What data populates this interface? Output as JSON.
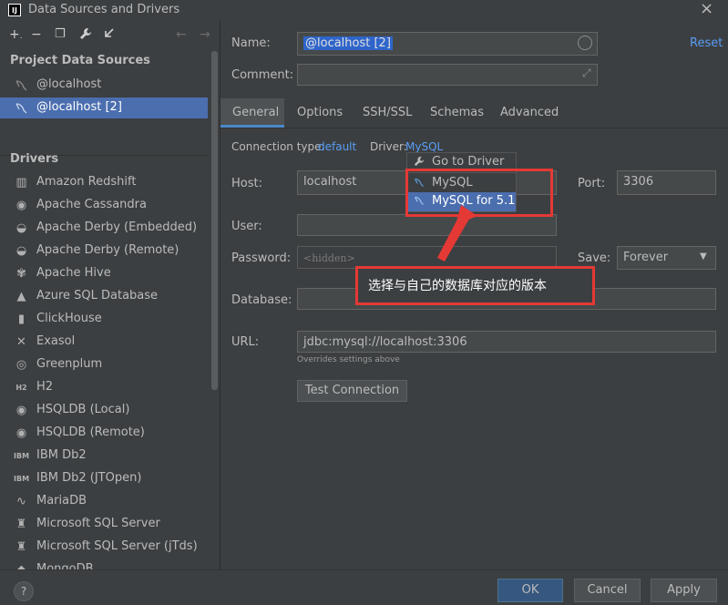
{
  "window": {
    "title": "Data Sources and Drivers",
    "logo": "IJ"
  },
  "toolbar": {
    "icons": [
      {
        "name": "add-icon",
        "glyph": "+."
      },
      {
        "name": "remove-icon",
        "glyph": "−"
      },
      {
        "name": "duplicate-icon",
        "glyph": "❐"
      },
      {
        "name": "wrench-icon",
        "glyph": "🔧"
      },
      {
        "name": "import-icon",
        "glyph": "↙"
      },
      {
        "name": "back-icon",
        "glyph": "←"
      },
      {
        "name": "forward-icon",
        "glyph": "→"
      }
    ]
  },
  "left": {
    "project_header": "Project Data Sources",
    "data_sources": [
      {
        "label": "@localhost",
        "selected": false
      },
      {
        "label": "@localhost [2]",
        "selected": true
      }
    ],
    "drivers_header": "Drivers",
    "drivers": [
      {
        "label": "Amazon Redshift",
        "icon": "▥"
      },
      {
        "label": "Apache Cassandra",
        "icon": "◉"
      },
      {
        "label": "Apache Derby (Embedded)",
        "icon": "◒"
      },
      {
        "label": "Apache Derby (Remote)",
        "icon": "◒"
      },
      {
        "label": "Apache Hive",
        "icon": "✾"
      },
      {
        "label": "Azure SQL Database",
        "icon": "▲"
      },
      {
        "label": "ClickHouse",
        "icon": "▮"
      },
      {
        "label": "Exasol",
        "icon": "✕"
      },
      {
        "label": "Greenplum",
        "icon": "◎"
      },
      {
        "label": "H2",
        "icon": "H2"
      },
      {
        "label": "HSQLDB (Local)",
        "icon": "◉"
      },
      {
        "label": "HSQLDB (Remote)",
        "icon": "◉"
      },
      {
        "label": "IBM Db2",
        "icon": "IBM"
      },
      {
        "label": "IBM Db2 (JTOpen)",
        "icon": "IBM"
      },
      {
        "label": "MariaDB",
        "icon": "∿"
      },
      {
        "label": "Microsoft SQL Server",
        "icon": "♜"
      },
      {
        "label": "Microsoft SQL Server (jTds)",
        "icon": "♜"
      },
      {
        "label": "MongoDB",
        "icon": "◆"
      }
    ]
  },
  "form": {
    "name_label": "Name:",
    "name_value": "@localhost [2]",
    "reset_label": "Reset",
    "comment_label": "Comment:",
    "tabs": [
      "General",
      "Options",
      "SSH/SSL",
      "Schemas",
      "Advanced"
    ],
    "active_tab": "General",
    "conn_type_label": "Connection type:",
    "conn_type_value": "default",
    "driver_label": "Driver:",
    "driver_value": "MySQL",
    "host_label": "Host:",
    "host_value": "localhost",
    "port_label": "Port:",
    "port_value": "3306",
    "user_label": "User:",
    "password_label": "Password:",
    "password_placeholder": "<hidden>",
    "save_label": "Save:",
    "save_value": "Forever",
    "database_label": "Database:",
    "url_label": "URL:",
    "url_value": "jdbc:mysql://localhost:3306",
    "url_hint": "Overrides settings above",
    "test_button": "Test Connection"
  },
  "popup": {
    "go_to_driver": "Go to Driver",
    "items": [
      {
        "label": "MySQL",
        "highlighted": false
      },
      {
        "label": "MySQL for 5.1",
        "highlighted": true
      }
    ]
  },
  "annotation": {
    "note": "选择与自己的数据库对应的版本",
    "color": "#e53935"
  },
  "footer": {
    "help": "?",
    "ok": "OK",
    "cancel": "Cancel",
    "apply": "Apply"
  },
  "colors": {
    "background": "#3c3f41",
    "selection": "#4b6eaf",
    "link": "#589df6",
    "ok_button": "#365880"
  }
}
